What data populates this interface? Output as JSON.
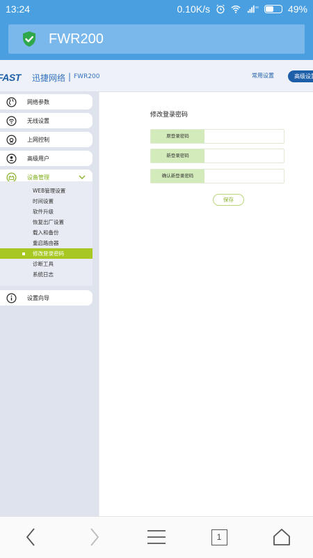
{
  "status_bar": {
    "time": "13:24",
    "net_speed": "0.10K/s",
    "network": "4G",
    "battery": "49%"
  },
  "app": {
    "title": "FWR200",
    "accent": "#4a9fe0"
  },
  "router_header": {
    "logo": "FAST",
    "brand": "迅捷网络",
    "separator": "|",
    "model": "FWR200",
    "common_settings": "常用设置",
    "advanced_settings": "高级设置"
  },
  "sidebar": {
    "items": [
      {
        "label": "网络参数",
        "icon": "globe-icon"
      },
      {
        "label": "无线设置",
        "icon": "wifi-icon"
      },
      {
        "label": "上网控制",
        "icon": "control-icon"
      },
      {
        "label": "高级用户",
        "icon": "user-icon"
      },
      {
        "label": "设备管理",
        "icon": "router-icon"
      },
      {
        "label": "设置向导",
        "icon": "info-icon"
      }
    ],
    "submenu": [
      "WEB管理设置",
      "时间设置",
      "软件升级",
      "恢复出厂设置",
      "载入和备份",
      "重启路由器",
      "修改登录密码",
      "诊断工具",
      "系统日志"
    ],
    "selected_sub": "修改登录密码"
  },
  "content": {
    "title": "修改登录密码",
    "fields": [
      {
        "label": "原登录密码",
        "value": ""
      },
      {
        "label": "新登录密码",
        "value": ""
      },
      {
        "label": "确认新登录密码",
        "value": ""
      }
    ],
    "save_label": "保存"
  },
  "bottom_nav": {
    "tab_count": "1"
  },
  "colors": {
    "brand_blue": "#1d5ea8",
    "green_accent": "#a7c723",
    "field_label_bg": "#d3ebbb"
  }
}
